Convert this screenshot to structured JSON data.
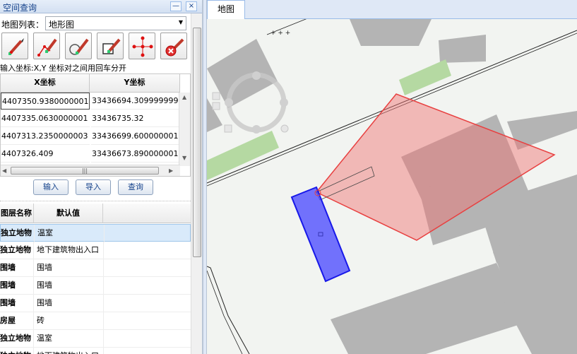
{
  "panel": {
    "title": "空间查询",
    "minimize_glyph": "—",
    "close_glyph": "×"
  },
  "map_list": {
    "label": "地图列表：",
    "selected": "地形图"
  },
  "tools": [
    {
      "name": "draw-point-icon"
    },
    {
      "name": "draw-line-icon"
    },
    {
      "name": "draw-circle-icon"
    },
    {
      "name": "draw-rectangle-icon"
    },
    {
      "name": "draw-polygon-icon"
    },
    {
      "name": "clear-icon"
    }
  ],
  "coord_hint": "输入坐标:X,Y 坐标对之间用回车分开",
  "coord_table": {
    "headers": [
      "X坐标",
      "Y坐标"
    ],
    "rows": [
      [
        "4407350.9380000001",
        "33436694.309999999"
      ],
      [
        "4407335.0630000001",
        "33436735.32"
      ],
      [
        "4407313.2350000003",
        "33436699.600000001"
      ],
      [
        "4407326.409",
        "33436673.890000001"
      ]
    ]
  },
  "buttons": {
    "input": "输入",
    "import": "导入",
    "query": "查询"
  },
  "layer_table": {
    "headers": [
      "图层名称",
      "默认值"
    ],
    "rows": [
      [
        "独立地物",
        "温室"
      ],
      [
        "独立地物",
        "地下建筑物出入口"
      ],
      [
        "围墙",
        "围墙"
      ],
      [
        "围墙",
        "围墙"
      ],
      [
        "围墙",
        "围墙"
      ],
      [
        "房屋",
        "砖"
      ],
      [
        "独立地物",
        "温室"
      ],
      [
        "独立地物",
        "地下建筑物出入口"
      ]
    ]
  },
  "map": {
    "tab_label": "地图"
  },
  "colors": {
    "header_blue": "#15428b",
    "polygon_red": "#f08080",
    "polygon_blue": "#3333ff",
    "building_gray": "#b4b4b4",
    "green_area": "#b5d9a2"
  }
}
